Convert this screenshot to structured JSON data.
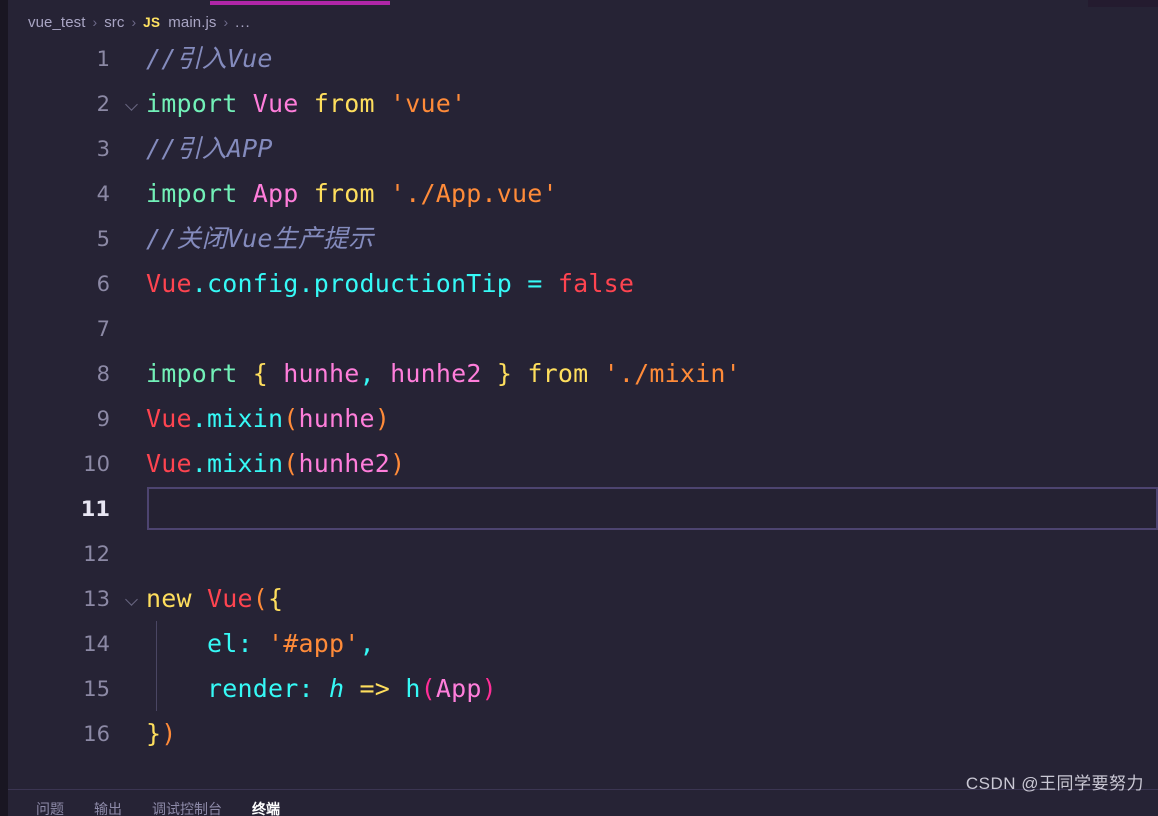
{
  "window": {
    "theme_background": "#262335",
    "accent_tab_underline": "#b026a8"
  },
  "breadcrumb": {
    "items": [
      {
        "label": "vue_test",
        "kind": "folder"
      },
      {
        "label": "src",
        "kind": "folder"
      },
      {
        "label": "main.js",
        "kind": "file",
        "badge": "JS"
      },
      {
        "label": "...",
        "kind": "symbols"
      }
    ],
    "separator": "›"
  },
  "editor": {
    "file_name": "main.js",
    "language": "JavaScript",
    "active_line": 11,
    "total_lines": 16,
    "lines": [
      {
        "n": "1",
        "fold": false,
        "indent_guide": false,
        "tokens": [
          {
            "t": "//引入Vue",
            "c": "t-comment"
          }
        ]
      },
      {
        "n": "2",
        "fold": true,
        "indent_guide": false,
        "tokens": [
          {
            "t": "import ",
            "c": "t-keyword"
          },
          {
            "t": "Vue ",
            "c": "t-class"
          },
          {
            "t": "from ",
            "c": "t-from"
          },
          {
            "t": "'vue'",
            "c": "t-string"
          }
        ]
      },
      {
        "n": "3",
        "fold": false,
        "indent_guide": false,
        "tokens": [
          {
            "t": "//引入APP",
            "c": "t-comment"
          }
        ]
      },
      {
        "n": "4",
        "fold": false,
        "indent_guide": false,
        "tokens": [
          {
            "t": "import ",
            "c": "t-keyword"
          },
          {
            "t": "App ",
            "c": "t-class"
          },
          {
            "t": "from ",
            "c": "t-from"
          },
          {
            "t": "'./App.vue'",
            "c": "t-string"
          }
        ]
      },
      {
        "n": "5",
        "fold": false,
        "indent_guide": false,
        "tokens": [
          {
            "t": "//关闭Vue生产提示",
            "c": "t-comment"
          }
        ]
      },
      {
        "n": "6",
        "fold": false,
        "indent_guide": false,
        "tokens": [
          {
            "t": "Vue",
            "c": "t-objred"
          },
          {
            "t": ".config.productionTip ",
            "c": "t-prop"
          },
          {
            "t": "= ",
            "c": "t-punct"
          },
          {
            "t": "false",
            "c": "t-objred"
          }
        ]
      },
      {
        "n": "7",
        "fold": false,
        "indent_guide": false,
        "tokens": []
      },
      {
        "n": "8",
        "fold": false,
        "indent_guide": false,
        "tokens": [
          {
            "t": "import ",
            "c": "t-keyword"
          },
          {
            "t": "{ ",
            "c": "t-brace-y"
          },
          {
            "t": "hunhe",
            "c": "t-class"
          },
          {
            "t": ", ",
            "c": "t-punct"
          },
          {
            "t": "hunhe2 ",
            "c": "t-class"
          },
          {
            "t": "} ",
            "c": "t-brace-y"
          },
          {
            "t": "from ",
            "c": "t-from"
          },
          {
            "t": "'./mixin'",
            "c": "t-string"
          }
        ]
      },
      {
        "n": "9",
        "fold": false,
        "indent_guide": false,
        "tokens": [
          {
            "t": "Vue",
            "c": "t-objred"
          },
          {
            "t": ".mixin",
            "c": "t-prop"
          },
          {
            "t": "(",
            "c": "t-paren-o"
          },
          {
            "t": "hunhe",
            "c": "t-class"
          },
          {
            "t": ")",
            "c": "t-paren-o"
          }
        ]
      },
      {
        "n": "10",
        "fold": false,
        "indent_guide": false,
        "tokens": [
          {
            "t": "Vue",
            "c": "t-objred"
          },
          {
            "t": ".mixin",
            "c": "t-prop"
          },
          {
            "t": "(",
            "c": "t-paren-o"
          },
          {
            "t": "hunhe2",
            "c": "t-class"
          },
          {
            "t": ")",
            "c": "t-paren-o"
          }
        ]
      },
      {
        "n": "11",
        "fold": false,
        "indent_guide": false,
        "tokens": []
      },
      {
        "n": "12",
        "fold": false,
        "indent_guide": false,
        "tokens": []
      },
      {
        "n": "13",
        "fold": true,
        "indent_guide": false,
        "tokens": [
          {
            "t": "new ",
            "c": "t-new"
          },
          {
            "t": "Vue",
            "c": "t-objred"
          },
          {
            "t": "(",
            "c": "t-paren-o"
          },
          {
            "t": "{",
            "c": "t-brace-y"
          }
        ]
      },
      {
        "n": "14",
        "fold": false,
        "indent_guide": true,
        "tokens": [
          {
            "t": "    el",
            "c": "t-prop"
          },
          {
            "t": ": ",
            "c": "t-punct"
          },
          {
            "t": "'#app'",
            "c": "t-string"
          },
          {
            "t": ",",
            "c": "t-punct"
          }
        ]
      },
      {
        "n": "15",
        "fold": false,
        "indent_guide": true,
        "tokens": [
          {
            "t": "    render",
            "c": "t-prop"
          },
          {
            "t": ": ",
            "c": "t-punct"
          },
          {
            "t": "h",
            "c": "t-param"
          },
          {
            "t": " => ",
            "c": "t-arrow"
          },
          {
            "t": "h",
            "c": "t-prop"
          },
          {
            "t": "(",
            "c": "t-paren-m"
          },
          {
            "t": "App",
            "c": "t-class"
          },
          {
            "t": ")",
            "c": "t-paren-m"
          }
        ]
      },
      {
        "n": "16",
        "fold": false,
        "indent_guide": false,
        "tokens": [
          {
            "t": "}",
            "c": "t-brace-y"
          },
          {
            "t": ")",
            "c": "t-paren-o"
          }
        ]
      }
    ]
  },
  "panel": {
    "tabs": [
      {
        "label": "问题",
        "active": false
      },
      {
        "label": "输出",
        "active": false
      },
      {
        "label": "调试控制台",
        "active": false
      },
      {
        "label": "终端",
        "active": true
      }
    ]
  },
  "watermark": {
    "text": "CSDN @王同学要努力"
  }
}
